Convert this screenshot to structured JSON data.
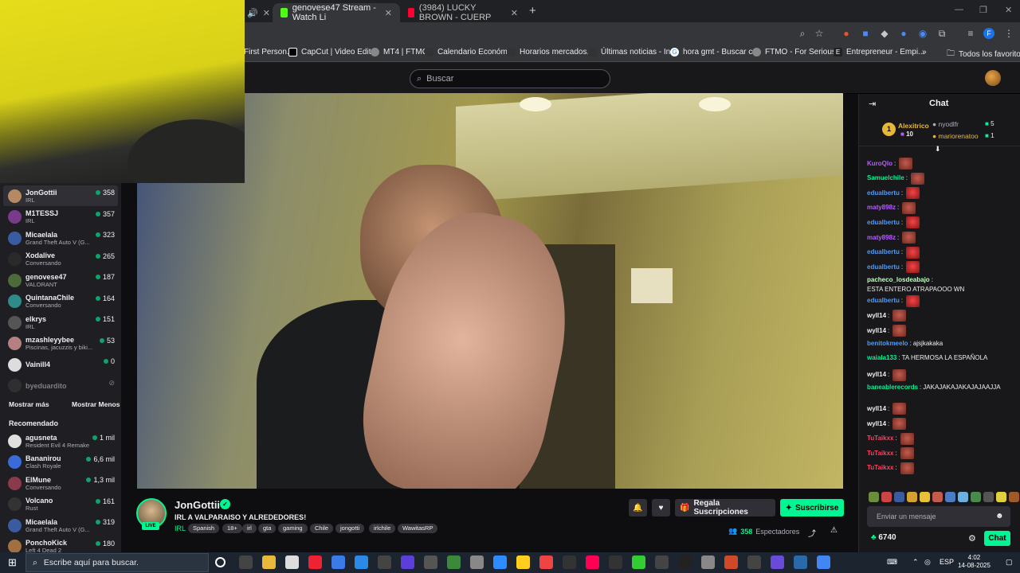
{
  "browser": {
    "tabs": [
      {
        "title": "genovese47 Stream - Watch Li",
        "color": "#53fc18"
      },
      {
        "title": "(3984) LUCKY BROWN - CUERP",
        "color": "#ff0033"
      }
    ],
    "new_tab": "+",
    "bookmarks": [
      "First Person...",
      "CapCut | Video Edit...",
      "MT4 | FTMO",
      "Calendario Económ...",
      "Horarios mercados...",
      "Últimas noticias - In...",
      "hora gmt - Buscar c...",
      "FTMO - For Serious...",
      "Entrepreneur - Empi..."
    ],
    "bookmarks_more": "»",
    "all_bookmarks": "Todos los favoritos",
    "profile_initial": "F"
  },
  "twitch": {
    "search_placeholder": "Buscar",
    "followed": [
      {
        "name": "JonGottii",
        "game": "IRL",
        "viewers": "358",
        "avatar": "#b58a63",
        "live": true
      },
      {
        "name": "M1TESSJ",
        "game": "IRL",
        "viewers": "357",
        "avatar": "#7a3a8a",
        "live": true
      },
      {
        "name": "Micaelala",
        "game": "Grand Theft Auto V (G...",
        "viewers": "323",
        "avatar": "#3a5ba0",
        "live": true
      },
      {
        "name": "Xodalive",
        "game": "Conversando",
        "viewers": "265",
        "avatar": "#2a2a2a",
        "live": true
      },
      {
        "name": "genovese47",
        "game": "VALORANT",
        "viewers": "187",
        "avatar": "#4d6b3a",
        "live": true
      },
      {
        "name": "QuintanaChile",
        "game": "Conversando",
        "viewers": "164",
        "avatar": "#2f8a8a",
        "live": true
      },
      {
        "name": "elkrys",
        "game": "IRL",
        "viewers": "151",
        "avatar": "#555",
        "live": true
      },
      {
        "name": "mzashleyybee",
        "game": "Piscinas, jacuzzis y biki...",
        "viewers": "53",
        "avatar": "#b58080",
        "live": true
      },
      {
        "name": "Vainill4",
        "game": "",
        "viewers": "0",
        "avatar": "#ddd",
        "live": true
      },
      {
        "name": "byeduardito",
        "game": "",
        "viewers": "",
        "avatar": "#444",
        "live": false
      }
    ],
    "show_more": "Mostrar más",
    "show_less": "Mostrar Menos",
    "recommended_title": "Recomendado",
    "recommended": [
      {
        "name": "agusneta",
        "game": "Resident Evil 4 Remake",
        "viewers": "1 mil",
        "avatar": "#e0e0e0"
      },
      {
        "name": "Bananirou",
        "game": "Clash Royale",
        "viewers": "6,6 mil",
        "avatar": "#3a6bd8"
      },
      {
        "name": "ElMune",
        "game": "Conversando",
        "viewers": "1,3 mil",
        "avatar": "#8a3a4a"
      },
      {
        "name": "Volcano",
        "game": "Rust",
        "viewers": "161",
        "avatar": "#333"
      },
      {
        "name": "Micaelala",
        "game": "Grand Theft Auto V (G...",
        "viewers": "319",
        "avatar": "#3a5ba0"
      },
      {
        "name": "PonchoKick",
        "game": "Left 4 Dead 2",
        "viewers": "180",
        "avatar": "#a07040"
      }
    ],
    "channel": {
      "name": "JonGottii",
      "title": "IRL A VALPARAISO Y ALREDEDORES!",
      "category": "IRL",
      "tags": [
        "Spanish",
        "18+",
        "irl",
        "gta",
        "gaming",
        "Chile",
        "jongotti",
        "irlchile",
        "WawitasRP"
      ],
      "live_label": "LIVE",
      "gift_label": "Regala Suscripciones",
      "subscribe_label": "Suscribirse",
      "viewers_count": "358",
      "viewers_label": "Espectadores"
    },
    "chat": {
      "title": "Chat",
      "leaderboard": [
        {
          "rank": "1",
          "name": "Alexitrico",
          "count": "10"
        },
        {
          "name": "nyodlfr",
          "count": "5"
        },
        {
          "name": "mariorenatoo",
          "count": "1"
        }
      ],
      "messages": [
        {
          "user": "KuroQlo",
          "color": "#b45cff",
          "text": "",
          "emotes": 1
        },
        {
          "user": "Samuelchile",
          "color": "#00f593",
          "text": "",
          "emotes": 1
        },
        {
          "user": "edualbertu",
          "color": "#4a9bff",
          "text": "",
          "emotes": 1,
          "red": true
        },
        {
          "user": "maty898z",
          "color": "#b45cff",
          "text": "",
          "emotes": 1
        },
        {
          "user": "edualbertu",
          "color": "#4a9bff",
          "text": "",
          "emotes": 1,
          "red": true
        },
        {
          "user": "maty898z",
          "color": "#b45cff",
          "text": "",
          "emotes": 1
        },
        {
          "user": "edualbertu",
          "color": "#4a9bff",
          "text": "",
          "emotes": 1,
          "red": true
        },
        {
          "user": "edualbertu",
          "color": "#4a9bff",
          "text": "",
          "emotes": 1,
          "red": true
        },
        {
          "user": "pacheco_losdeabajo",
          "color": "#c0ffc0",
          "text": "ESTA ENTERO ATRAPAOOO WN",
          "emotes": 0
        },
        {
          "user": "edualbertu",
          "color": "#4a9bff",
          "text": "",
          "emotes": 1,
          "red": true
        },
        {
          "user": "wyll14",
          "color": "#efeff1",
          "text": "",
          "emotes": 1
        },
        {
          "user": "wyll14",
          "color": "#efeff1",
          "text": "",
          "emotes": 1
        },
        {
          "user": "benitokmeelo",
          "color": "#4a9bff",
          "text": "ajsjkakaka",
          "emotes": 0
        },
        {
          "user": "waiala133",
          "color": "#00f593",
          "text": "TA HERMOSA LA ESPAÑOLA",
          "emotes": 0
        },
        {
          "user": "wyll14",
          "color": "#efeff1",
          "text": "",
          "emotes": 1
        },
        {
          "user": "baneablerecords",
          "color": "#00f593",
          "text": "JAKAJAKAJAKAJAJAAJJA",
          "emotes": 0
        },
        {
          "user": "wyll14",
          "color": "#efeff1",
          "text": "",
          "emotes": 1
        },
        {
          "user": "wyll14",
          "color": "#efeff1",
          "text": "",
          "emotes": 1
        },
        {
          "user": "TuTaikxx",
          "color": "#ff3f5f",
          "text": "",
          "emotes": 1
        },
        {
          "user": "TuTaikxx",
          "color": "#ff3f5f",
          "text": "",
          "emotes": 1
        },
        {
          "user": "TuTaikxx",
          "color": "#ff3f5f",
          "text": "",
          "emotes": 1
        }
      ],
      "input_placeholder": "Enviar un mensaje",
      "points": "6740",
      "chat_button": "Chat"
    }
  },
  "taskbar": {
    "search_placeholder": "Escribe aquí para buscar.",
    "lang": "ESP",
    "time": "4:02",
    "date": "14-08-2025"
  },
  "colors": {
    "accent": "#00f593",
    "bg": "#0e0e10",
    "panel": "#18181b"
  }
}
